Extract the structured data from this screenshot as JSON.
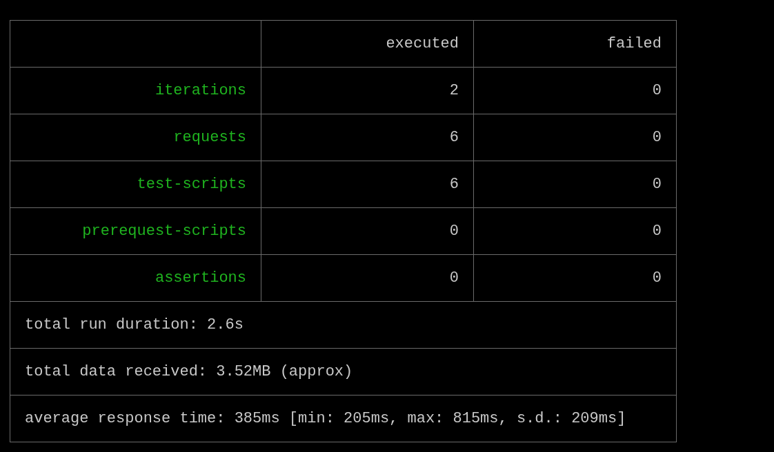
{
  "table": {
    "columns": [
      "executed",
      "failed"
    ],
    "rows": [
      {
        "label": "iterations",
        "executed": "2",
        "failed": "0"
      },
      {
        "label": "requests",
        "executed": "6",
        "failed": "0"
      },
      {
        "label": "test-scripts",
        "executed": "6",
        "failed": "0"
      },
      {
        "label": "prerequest-scripts",
        "executed": "0",
        "failed": "0"
      },
      {
        "label": "assertions",
        "executed": "0",
        "failed": "0"
      }
    ],
    "summary": [
      "total run duration: 2.6s",
      "total data received: 3.52MB (approx)",
      "average response time: 385ms [min: 205ms, max: 815ms, s.d.: 209ms]"
    ]
  }
}
